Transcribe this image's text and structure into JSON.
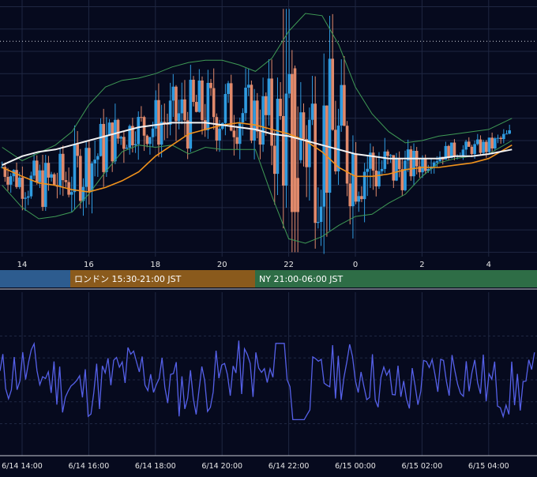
{
  "colors": {
    "background": "#060a1e",
    "grid": "#1f2742",
    "candle_up": "#2f9be0",
    "candle_down": "#e0896b",
    "bollinger": "#3f9a55",
    "ma_short": "#f0921c",
    "ma_long": "#f2f2f2",
    "oscillator": "#5560e8",
    "axis_text": "#e6e6e6",
    "dotted_line": "#cfd3dc"
  },
  "sessions": [
    {
      "label": "",
      "color": "#2d5c8f"
    },
    {
      "label": "ロンドン 15:30-21:00 JST",
      "color": "#8a5a1c"
    },
    {
      "label": "NY 21:00-06:00 JST",
      "color": "#2e6d46"
    }
  ],
  "chart_data": [
    {
      "type": "candlestick",
      "x_ticks": [
        "14",
        "16",
        "18",
        "20",
        "22",
        "0",
        "2",
        "4"
      ],
      "series": [
        {
          "kind": "ohlc"
        },
        {
          "kind": "bollinger_upper",
          "values": [
            [
              13.4,
              -0.3
            ],
            [
              14,
              -0.9
            ],
            [
              15,
              -0.2
            ],
            [
              15.5,
              0.4
            ],
            [
              16,
              1.6
            ],
            [
              16.5,
              2.4
            ],
            [
              17,
              2.7
            ],
            [
              17.5,
              2.8
            ],
            [
              18,
              3.0
            ],
            [
              18.5,
              3.3
            ],
            [
              19,
              3.5
            ],
            [
              19.5,
              3.6
            ],
            [
              20,
              3.6
            ],
            [
              20.5,
              3.4
            ],
            [
              21,
              3.1
            ],
            [
              21.5,
              3.7
            ],
            [
              22,
              4.9
            ],
            [
              22.5,
              5.7
            ],
            [
              23,
              5.6
            ],
            [
              23.5,
              4.3
            ],
            [
              0,
              2.4
            ],
            [
              0.5,
              1.2
            ],
            [
              1,
              0.4
            ],
            [
              1.5,
              -0.1
            ],
            [
              2,
              0
            ],
            [
              2.5,
              0.2
            ],
            [
              3,
              0.3
            ],
            [
              3.5,
              0.4
            ],
            [
              4,
              0.5
            ],
            [
              4.7,
              1.0
            ]
          ]
        },
        {
          "kind": "bollinger_lower",
          "values": [
            [
              13.4,
              -2.0
            ],
            [
              14,
              -3.0
            ],
            [
              14.5,
              -3.5
            ],
            [
              15,
              -3.4
            ],
            [
              15.5,
              -3.2
            ],
            [
              16,
              -2.4
            ],
            [
              16.5,
              -1.4
            ],
            [
              17,
              -0.5
            ],
            [
              17.5,
              -0.2
            ],
            [
              18,
              -0.3
            ],
            [
              18.5,
              -0.2
            ],
            [
              19,
              -0.6
            ],
            [
              19.5,
              -0.3
            ],
            [
              20,
              -0.4
            ],
            [
              20.5,
              -0.4
            ],
            [
              21,
              -0.4
            ],
            [
              21.5,
              -2.5
            ],
            [
              22,
              -4.4
            ],
            [
              22.5,
              -4.6
            ],
            [
              23,
              -4.3
            ],
            [
              23.5,
              -3.8
            ],
            [
              0,
              -3.4
            ],
            [
              0.5,
              -3.3
            ],
            [
              1,
              -2.8
            ],
            [
              1.5,
              -2.4
            ],
            [
              2,
              -1.6
            ],
            [
              2.5,
              -1.0
            ],
            [
              3,
              -0.8
            ],
            [
              3.5,
              -0.7
            ],
            [
              4,
              -0.6
            ],
            [
              4.7,
              0
            ]
          ]
        },
        {
          "kind": "ma_short",
          "values": [
            [
              13.4,
              -1.2
            ],
            [
              14,
              -1.6
            ],
            [
              14.5,
              -1.9
            ],
            [
              15,
              -2.0
            ],
            [
              15.5,
              -2.2
            ],
            [
              16,
              -2.3
            ],
            [
              16.5,
              -2.1
            ],
            [
              17,
              -1.8
            ],
            [
              17.5,
              -1.4
            ],
            [
              18,
              -0.7
            ],
            [
              18.5,
              -0.2
            ],
            [
              19,
              0.3
            ],
            [
              19.5,
              0.5
            ],
            [
              20,
              0.7
            ],
            [
              20.5,
              0.8
            ],
            [
              21,
              0.7
            ],
            [
              21.5,
              0.5
            ],
            [
              22,
              0.3
            ],
            [
              22.5,
              0
            ],
            [
              23,
              -0.5
            ],
            [
              23.5,
              -1.2
            ],
            [
              0,
              -1.6
            ],
            [
              0.5,
              -1.6
            ],
            [
              1,
              -1.5
            ],
            [
              1.5,
              -1.3
            ],
            [
              2,
              -1.2
            ],
            [
              2.5,
              -1.2
            ],
            [
              3,
              -1.1
            ],
            [
              3.5,
              -1.0
            ],
            [
              4,
              -0.8
            ],
            [
              4.7,
              -0.2
            ]
          ]
        },
        {
          "kind": "ma_long",
          "values": [
            [
              13.4,
              -1.1
            ],
            [
              14,
              -0.7
            ],
            [
              14.5,
              -0.5
            ],
            [
              15,
              -0.4
            ],
            [
              15.5,
              -0.2
            ],
            [
              16,
              0
            ],
            [
              16.5,
              0.2
            ],
            [
              17,
              0.4
            ],
            [
              17.5,
              0.6
            ],
            [
              18,
              0.7
            ],
            [
              18.5,
              0.8
            ],
            [
              19,
              0.8
            ],
            [
              19.5,
              0.8
            ],
            [
              20,
              0.7
            ],
            [
              20.5,
              0.6
            ],
            [
              21,
              0.5
            ],
            [
              21.5,
              0.3
            ],
            [
              22,
              0.2
            ],
            [
              22.5,
              0
            ],
            [
              23,
              -0.2
            ],
            [
              23.5,
              -0.4
            ],
            [
              0,
              -0.6
            ],
            [
              0.5,
              -0.7
            ],
            [
              1,
              -0.8
            ],
            [
              1.5,
              -0.8
            ],
            [
              2,
              -0.8
            ],
            [
              2.5,
              -0.8
            ],
            [
              3,
              -0.7
            ],
            [
              3.5,
              -0.7
            ],
            [
              4,
              -0.6
            ],
            [
              4.7,
              -0.4
            ]
          ]
        }
      ],
      "ylim": [
        -5.2,
        6.3
      ],
      "grid": true,
      "reference_line": 4.45
    },
    {
      "type": "line",
      "x_ticks": [
        "6/14 14:00",
        "6/14 16:00",
        "6/14 18:00",
        "6/14 20:00",
        "6/14 22:00",
        "6/15 00:00",
        "6/15 02:00",
        "6/15 04:00"
      ],
      "ylim": [
        -1,
        1
      ],
      "grid": true
    }
  ]
}
